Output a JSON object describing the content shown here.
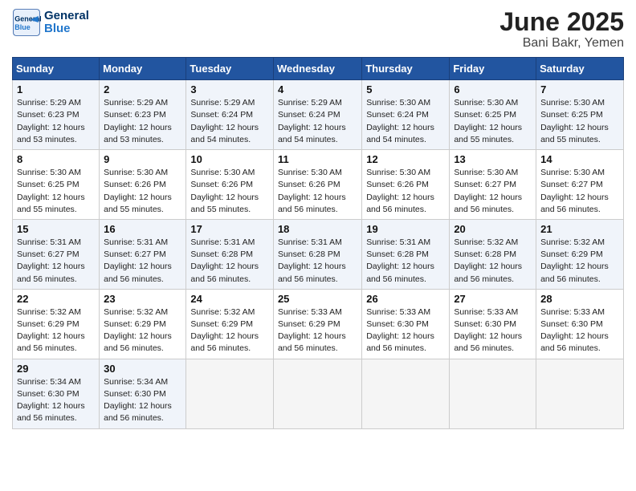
{
  "header": {
    "logo_line1": "General",
    "logo_line2": "Blue",
    "title": "June 2025",
    "subtitle": "Bani Bakr, Yemen"
  },
  "weekdays": [
    "Sunday",
    "Monday",
    "Tuesday",
    "Wednesday",
    "Thursday",
    "Friday",
    "Saturday"
  ],
  "weeks": [
    [
      {
        "day": "1",
        "sunrise": "5:29 AM",
        "sunset": "6:23 PM",
        "daylight": "12 hours and 53 minutes."
      },
      {
        "day": "2",
        "sunrise": "5:29 AM",
        "sunset": "6:23 PM",
        "daylight": "12 hours and 53 minutes."
      },
      {
        "day": "3",
        "sunrise": "5:29 AM",
        "sunset": "6:24 PM",
        "daylight": "12 hours and 54 minutes."
      },
      {
        "day": "4",
        "sunrise": "5:29 AM",
        "sunset": "6:24 PM",
        "daylight": "12 hours and 54 minutes."
      },
      {
        "day": "5",
        "sunrise": "5:30 AM",
        "sunset": "6:24 PM",
        "daylight": "12 hours and 54 minutes."
      },
      {
        "day": "6",
        "sunrise": "5:30 AM",
        "sunset": "6:25 PM",
        "daylight": "12 hours and 55 minutes."
      },
      {
        "day": "7",
        "sunrise": "5:30 AM",
        "sunset": "6:25 PM",
        "daylight": "12 hours and 55 minutes."
      }
    ],
    [
      {
        "day": "8",
        "sunrise": "5:30 AM",
        "sunset": "6:25 PM",
        "daylight": "12 hours and 55 minutes."
      },
      {
        "day": "9",
        "sunrise": "5:30 AM",
        "sunset": "6:26 PM",
        "daylight": "12 hours and 55 minutes."
      },
      {
        "day": "10",
        "sunrise": "5:30 AM",
        "sunset": "6:26 PM",
        "daylight": "12 hours and 55 minutes."
      },
      {
        "day": "11",
        "sunrise": "5:30 AM",
        "sunset": "6:26 PM",
        "daylight": "12 hours and 56 minutes."
      },
      {
        "day": "12",
        "sunrise": "5:30 AM",
        "sunset": "6:26 PM",
        "daylight": "12 hours and 56 minutes."
      },
      {
        "day": "13",
        "sunrise": "5:30 AM",
        "sunset": "6:27 PM",
        "daylight": "12 hours and 56 minutes."
      },
      {
        "day": "14",
        "sunrise": "5:30 AM",
        "sunset": "6:27 PM",
        "daylight": "12 hours and 56 minutes."
      }
    ],
    [
      {
        "day": "15",
        "sunrise": "5:31 AM",
        "sunset": "6:27 PM",
        "daylight": "12 hours and 56 minutes."
      },
      {
        "day": "16",
        "sunrise": "5:31 AM",
        "sunset": "6:27 PM",
        "daylight": "12 hours and 56 minutes."
      },
      {
        "day": "17",
        "sunrise": "5:31 AM",
        "sunset": "6:28 PM",
        "daylight": "12 hours and 56 minutes."
      },
      {
        "day": "18",
        "sunrise": "5:31 AM",
        "sunset": "6:28 PM",
        "daylight": "12 hours and 56 minutes."
      },
      {
        "day": "19",
        "sunrise": "5:31 AM",
        "sunset": "6:28 PM",
        "daylight": "12 hours and 56 minutes."
      },
      {
        "day": "20",
        "sunrise": "5:32 AM",
        "sunset": "6:28 PM",
        "daylight": "12 hours and 56 minutes."
      },
      {
        "day": "21",
        "sunrise": "5:32 AM",
        "sunset": "6:29 PM",
        "daylight": "12 hours and 56 minutes."
      }
    ],
    [
      {
        "day": "22",
        "sunrise": "5:32 AM",
        "sunset": "6:29 PM",
        "daylight": "12 hours and 56 minutes."
      },
      {
        "day": "23",
        "sunrise": "5:32 AM",
        "sunset": "6:29 PM",
        "daylight": "12 hours and 56 minutes."
      },
      {
        "day": "24",
        "sunrise": "5:32 AM",
        "sunset": "6:29 PM",
        "daylight": "12 hours and 56 minutes."
      },
      {
        "day": "25",
        "sunrise": "5:33 AM",
        "sunset": "6:29 PM",
        "daylight": "12 hours and 56 minutes."
      },
      {
        "day": "26",
        "sunrise": "5:33 AM",
        "sunset": "6:30 PM",
        "daylight": "12 hours and 56 minutes."
      },
      {
        "day": "27",
        "sunrise": "5:33 AM",
        "sunset": "6:30 PM",
        "daylight": "12 hours and 56 minutes."
      },
      {
        "day": "28",
        "sunrise": "5:33 AM",
        "sunset": "6:30 PM",
        "daylight": "12 hours and 56 minutes."
      }
    ],
    [
      {
        "day": "29",
        "sunrise": "5:34 AM",
        "sunset": "6:30 PM",
        "daylight": "12 hours and 56 minutes."
      },
      {
        "day": "30",
        "sunrise": "5:34 AM",
        "sunset": "6:30 PM",
        "daylight": "12 hours and 56 minutes."
      },
      null,
      null,
      null,
      null,
      null
    ]
  ]
}
